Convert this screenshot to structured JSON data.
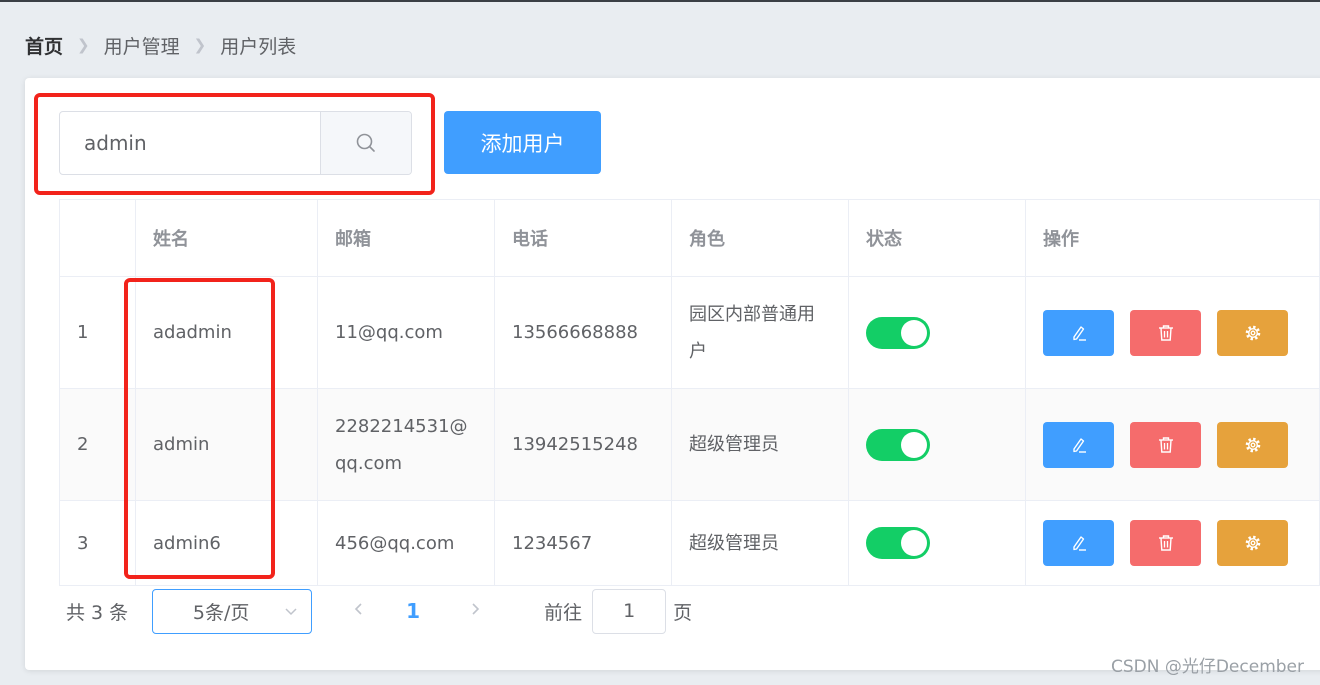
{
  "breadcrumb": [
    "首页",
    "用户管理",
    "用户列表"
  ],
  "search": {
    "value": "admin",
    "icon": "search-icon"
  },
  "add_button": "添加用户",
  "table": {
    "headers": [
      "",
      "姓名",
      "邮箱",
      "电话",
      "角色",
      "状态",
      "操作"
    ],
    "rows": [
      {
        "index": "1",
        "name": "adadmin",
        "email": "11@qq.com",
        "phone": "13566668888",
        "role": "园区内部普通用户",
        "status": true
      },
      {
        "index": "2",
        "name": "admin",
        "email": "2282214531@qq.com",
        "phone": "13942515248",
        "role": "超级管理员",
        "status": true
      },
      {
        "index": "3",
        "name": "admin6",
        "email": "456@qq.com",
        "phone": "1234567",
        "role": "超级管理员",
        "status": true
      }
    ]
  },
  "pagination": {
    "total": "共 3 条",
    "page_size": "5条/页",
    "current": "1",
    "goto_label": "前往",
    "goto_value": "1",
    "page_label": "页"
  },
  "watermark": "CSDN @光仔December",
  "colors": {
    "primary": "#409eff",
    "danger": "#f56c6c",
    "warning": "#e6a23c",
    "switch_on": "#13ce66",
    "highlight": "#f2231b"
  }
}
